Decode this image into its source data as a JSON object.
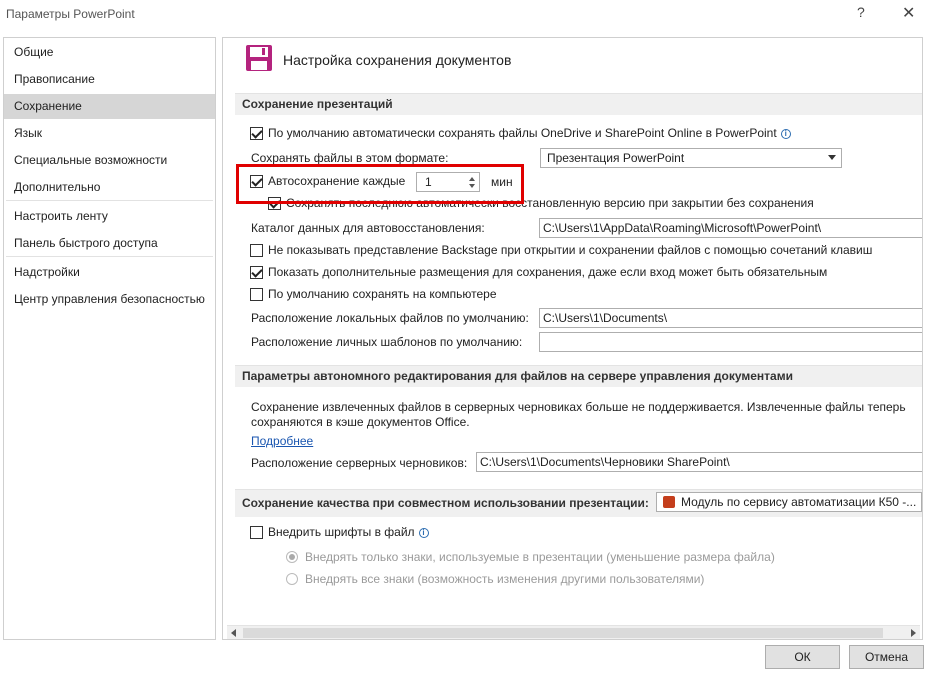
{
  "window": {
    "title": "Параметры PowerPoint",
    "help_label": "?",
    "close_label": "✕"
  },
  "sidebar": {
    "items": [
      {
        "label": "Общие"
      },
      {
        "label": "Правописание"
      },
      {
        "label": "Сохранение"
      },
      {
        "label": "Язык"
      },
      {
        "label": "Специальные возможности"
      },
      {
        "label": "Дополнительно"
      },
      {
        "label": "Настроить ленту"
      },
      {
        "label": "Панель быстрого доступа"
      },
      {
        "label": "Надстройки"
      },
      {
        "label": "Центр управления безопасностью"
      }
    ],
    "active_index": 2
  },
  "header": {
    "title": "Настройка сохранения документов",
    "icon": "floppy-disk-icon"
  },
  "save_section": {
    "title": "Сохранение презентаций",
    "autosave_cloud_label": "По умолчанию автоматически сохранять файлы OneDrive и SharePoint Online в PowerPoint",
    "format_label": "Сохранять файлы в этом формате:",
    "format_value": "Презентация PowerPoint",
    "autorecover_label": "Автосохранение каждые",
    "autorecover_value": "1",
    "autorecover_unit": "мин",
    "keep_last_label": "Сохранять последнюю автоматически восстановленную версию при закрытии без сохранения",
    "autorecover_dir_label": "Каталог данных для автовосстановления:",
    "autorecover_dir_value": "C:\\Users\\1\\AppData\\Roaming\\Microsoft\\PowerPoint\\",
    "no_backstage_label": "Не показывать представление Backstage при открытии и сохранении файлов с помощью сочетаний клавиш",
    "show_locations_label": "Показать дополнительные размещения для сохранения, даже если вход может быть обязательным",
    "save_local_label": "По умолчанию сохранять на компьютере",
    "local_files_label": "Расположение локальных файлов по умолчанию:",
    "local_files_value": "C:\\Users\\1\\Documents\\",
    "templates_label": "Расположение личных шаблонов по умолчанию:",
    "templates_value": ""
  },
  "offline_section": {
    "title": "Параметры автономного редактирования для файлов на сервере управления документами",
    "note_line1": "Сохранение извлеченных файлов в серверных черновиках больше не поддерживается. Извлеченные файлы теперь",
    "note_line2": "сохраняются в кэше документов Office.",
    "more_link": "Подробнее",
    "drafts_label": "Расположение серверных черновиков:",
    "drafts_value": "C:\\Users\\1\\Documents\\Черновики SharePoint\\"
  },
  "quality_section": {
    "title": "Сохранение качества при совместном использовании презентации:",
    "presentation_value": "Модуль по сервису автоматизации К50 -...",
    "embed_fonts_label": "Внедрить шрифты в файл",
    "embed_used_label": "Внедрять только знаки, используемые в презентации (уменьшение размера файла)",
    "embed_all_label": "Внедрять все знаки (возможность изменения другими пользователями)"
  },
  "footer": {
    "ok_label": "ОК",
    "cancel_label": "Отмена"
  },
  "colors": {
    "highlight_box": "#e00000",
    "floppy_icon": "#b4237e",
    "link": "#1a56b0"
  }
}
